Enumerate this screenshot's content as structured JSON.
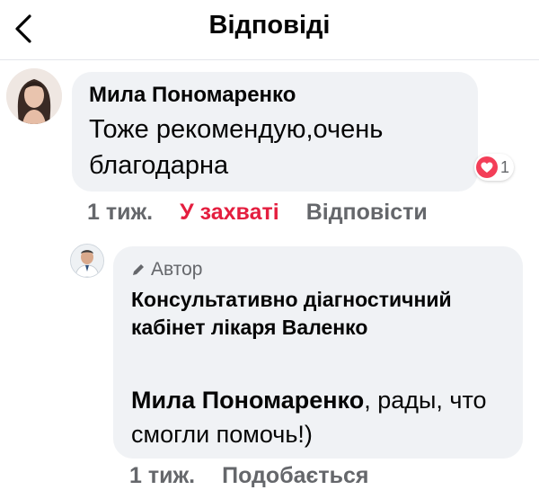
{
  "header": {
    "title": "Відповіді",
    "back_icon": "chevron-left-icon"
  },
  "comments": [
    {
      "author": "Мила Пономаренко",
      "text": "Тоже рекомендую,очень благодарна",
      "reaction": {
        "icon": "heart-icon",
        "count": "1",
        "color": "#f33e58"
      },
      "time": "1 тиж.",
      "like_label": "У захваті",
      "reply_label": "Відповісти"
    },
    {
      "badge": "Автор",
      "badge_icon": "pencil-icon",
      "author": "Консультативно діагностичний кабінет лікаря Валенко",
      "mention": "Мила Пономаренко",
      "text": ", рады, что смогли помочь!)",
      "time": "1 тиж.",
      "like_label": "Подобається"
    }
  ],
  "colors": {
    "liked": "#e41e3f",
    "meta": "#65676b",
    "bubble": "#f0f2f5"
  }
}
